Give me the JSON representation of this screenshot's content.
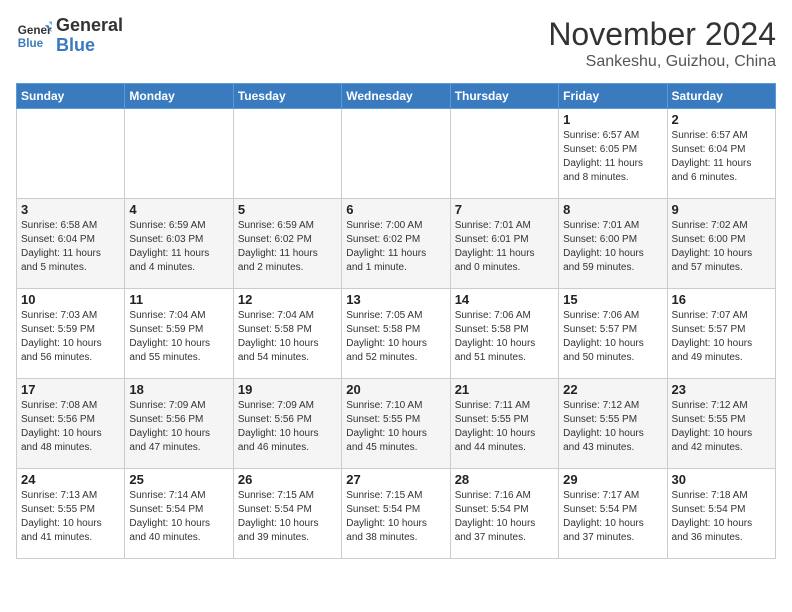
{
  "header": {
    "logo_line1": "General",
    "logo_line2": "Blue",
    "title": "November 2024",
    "subtitle": "Sankeshu, Guizhou, China"
  },
  "days_of_week": [
    "Sunday",
    "Monday",
    "Tuesday",
    "Wednesday",
    "Thursday",
    "Friday",
    "Saturday"
  ],
  "weeks": [
    [
      {
        "day": "",
        "info": ""
      },
      {
        "day": "",
        "info": ""
      },
      {
        "day": "",
        "info": ""
      },
      {
        "day": "",
        "info": ""
      },
      {
        "day": "",
        "info": ""
      },
      {
        "day": "1",
        "info": "Sunrise: 6:57 AM\nSunset: 6:05 PM\nDaylight: 11 hours\nand 8 minutes."
      },
      {
        "day": "2",
        "info": "Sunrise: 6:57 AM\nSunset: 6:04 PM\nDaylight: 11 hours\nand 6 minutes."
      }
    ],
    [
      {
        "day": "3",
        "info": "Sunrise: 6:58 AM\nSunset: 6:04 PM\nDaylight: 11 hours\nand 5 minutes."
      },
      {
        "day": "4",
        "info": "Sunrise: 6:59 AM\nSunset: 6:03 PM\nDaylight: 11 hours\nand 4 minutes."
      },
      {
        "day": "5",
        "info": "Sunrise: 6:59 AM\nSunset: 6:02 PM\nDaylight: 11 hours\nand 2 minutes."
      },
      {
        "day": "6",
        "info": "Sunrise: 7:00 AM\nSunset: 6:02 PM\nDaylight: 11 hours\nand 1 minute."
      },
      {
        "day": "7",
        "info": "Sunrise: 7:01 AM\nSunset: 6:01 PM\nDaylight: 11 hours\nand 0 minutes."
      },
      {
        "day": "8",
        "info": "Sunrise: 7:01 AM\nSunset: 6:00 PM\nDaylight: 10 hours\nand 59 minutes."
      },
      {
        "day": "9",
        "info": "Sunrise: 7:02 AM\nSunset: 6:00 PM\nDaylight: 10 hours\nand 57 minutes."
      }
    ],
    [
      {
        "day": "10",
        "info": "Sunrise: 7:03 AM\nSunset: 5:59 PM\nDaylight: 10 hours\nand 56 minutes."
      },
      {
        "day": "11",
        "info": "Sunrise: 7:04 AM\nSunset: 5:59 PM\nDaylight: 10 hours\nand 55 minutes."
      },
      {
        "day": "12",
        "info": "Sunrise: 7:04 AM\nSunset: 5:58 PM\nDaylight: 10 hours\nand 54 minutes."
      },
      {
        "day": "13",
        "info": "Sunrise: 7:05 AM\nSunset: 5:58 PM\nDaylight: 10 hours\nand 52 minutes."
      },
      {
        "day": "14",
        "info": "Sunrise: 7:06 AM\nSunset: 5:58 PM\nDaylight: 10 hours\nand 51 minutes."
      },
      {
        "day": "15",
        "info": "Sunrise: 7:06 AM\nSunset: 5:57 PM\nDaylight: 10 hours\nand 50 minutes."
      },
      {
        "day": "16",
        "info": "Sunrise: 7:07 AM\nSunset: 5:57 PM\nDaylight: 10 hours\nand 49 minutes."
      }
    ],
    [
      {
        "day": "17",
        "info": "Sunrise: 7:08 AM\nSunset: 5:56 PM\nDaylight: 10 hours\nand 48 minutes."
      },
      {
        "day": "18",
        "info": "Sunrise: 7:09 AM\nSunset: 5:56 PM\nDaylight: 10 hours\nand 47 minutes."
      },
      {
        "day": "19",
        "info": "Sunrise: 7:09 AM\nSunset: 5:56 PM\nDaylight: 10 hours\nand 46 minutes."
      },
      {
        "day": "20",
        "info": "Sunrise: 7:10 AM\nSunset: 5:55 PM\nDaylight: 10 hours\nand 45 minutes."
      },
      {
        "day": "21",
        "info": "Sunrise: 7:11 AM\nSunset: 5:55 PM\nDaylight: 10 hours\nand 44 minutes."
      },
      {
        "day": "22",
        "info": "Sunrise: 7:12 AM\nSunset: 5:55 PM\nDaylight: 10 hours\nand 43 minutes."
      },
      {
        "day": "23",
        "info": "Sunrise: 7:12 AM\nSunset: 5:55 PM\nDaylight: 10 hours\nand 42 minutes."
      }
    ],
    [
      {
        "day": "24",
        "info": "Sunrise: 7:13 AM\nSunset: 5:55 PM\nDaylight: 10 hours\nand 41 minutes."
      },
      {
        "day": "25",
        "info": "Sunrise: 7:14 AM\nSunset: 5:54 PM\nDaylight: 10 hours\nand 40 minutes."
      },
      {
        "day": "26",
        "info": "Sunrise: 7:15 AM\nSunset: 5:54 PM\nDaylight: 10 hours\nand 39 minutes."
      },
      {
        "day": "27",
        "info": "Sunrise: 7:15 AM\nSunset: 5:54 PM\nDaylight: 10 hours\nand 38 minutes."
      },
      {
        "day": "28",
        "info": "Sunrise: 7:16 AM\nSunset: 5:54 PM\nDaylight: 10 hours\nand 37 minutes."
      },
      {
        "day": "29",
        "info": "Sunrise: 7:17 AM\nSunset: 5:54 PM\nDaylight: 10 hours\nand 37 minutes."
      },
      {
        "day": "30",
        "info": "Sunrise: 7:18 AM\nSunset: 5:54 PM\nDaylight: 10 hours\nand 36 minutes."
      }
    ]
  ]
}
